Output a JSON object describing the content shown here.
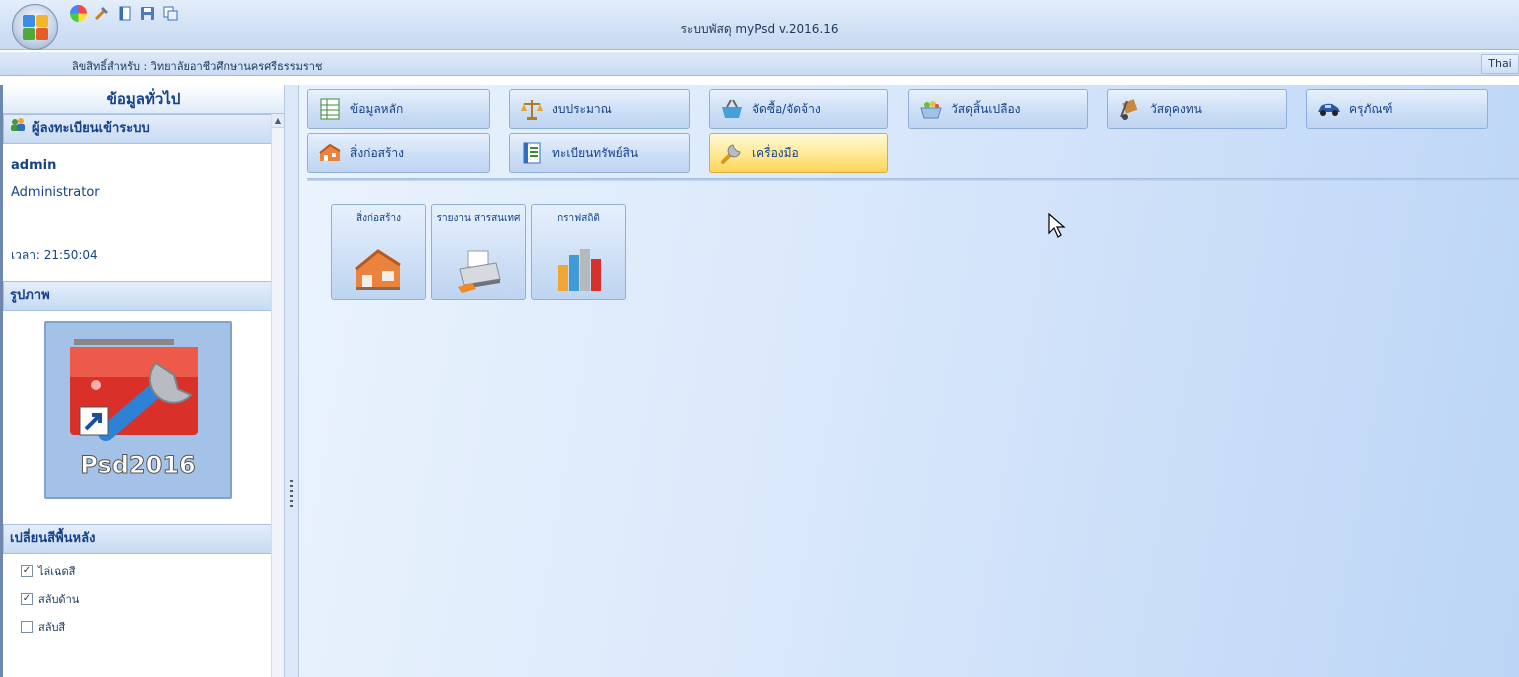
{
  "window": {
    "title": "ระบบพัสดุ myPsd v.2016.16",
    "license": "ลิขสิทธิ์สำหรับ :  วิทยาลัยอาชีวศึกษานครศรีธรรมราช",
    "lang": "Thai"
  },
  "quick_access": [
    "color-wheel-icon",
    "tools-icon",
    "notebook-icon",
    "save-icon",
    "copy-icon"
  ],
  "left_panel": {
    "header": "ข้อมูลทั่วไป",
    "login_section": "ผู้ลงทะเบียนเข้าระบบ",
    "username": "admin",
    "role": "Administrator",
    "time": "เวลา: 21:50:04",
    "picture_section": "รูปภาพ",
    "picture_label": "Psd2016",
    "bg_section": "เปลี่ยนสีพื้นหลัง",
    "options": [
      {
        "label": "ไล่เฉดสี",
        "checked": true
      },
      {
        "label": "สลับด้าน",
        "checked": true
      },
      {
        "label": "สลับสี",
        "checked": false
      }
    ]
  },
  "menu": {
    "row1": [
      "ข้อมูลหลัก",
      "งบประมาณ",
      "จัดซื้อ/จัดจ้าง",
      "วัสดุสิ้นเปลือง",
      "วัสดุคงทน",
      "ครุภัณฑ์"
    ],
    "row2": [
      "สิ่งก่อสร้าง",
      "ทะเบียนทรัพย์สิน",
      "เครื่องมือ"
    ],
    "active": "เครื่องมือ"
  },
  "tools": [
    "สิ่งก่อสร้าง",
    "รายงาน สารสนเทศ",
    "กราฟสถิติ"
  ],
  "colors": {
    "accent": "#15428b",
    "active_button": "#ffd659"
  }
}
